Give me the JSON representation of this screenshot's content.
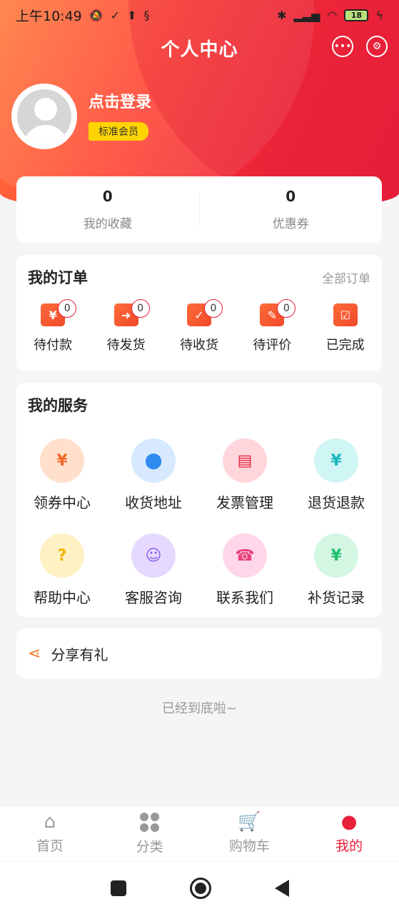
{
  "status_bar": {
    "time": "上午10:49",
    "battery": "18"
  },
  "header": {
    "title": "个人中心"
  },
  "profile": {
    "login_text": "点击登录",
    "member_level": "标准会员"
  },
  "stats": [
    {
      "value": "0",
      "label": "我的收藏"
    },
    {
      "value": "0",
      "label": "优惠券"
    }
  ],
  "orders": {
    "title": "我的订单",
    "all_link": "全部订单",
    "items": [
      {
        "label": "待付款",
        "count": "0",
        "icon": "payment-icon"
      },
      {
        "label": "待发货",
        "count": "0",
        "icon": "shipping-truck-icon"
      },
      {
        "label": "待收货",
        "count": "0",
        "icon": "receive-box-icon"
      },
      {
        "label": "待评价",
        "count": "0",
        "icon": "review-pen-icon"
      },
      {
        "label": "已完成",
        "icon": "completed-check-icon"
      }
    ]
  },
  "services": {
    "title": "我的服务",
    "items": [
      {
        "label": "领券中心",
        "icon": "coupon-icon",
        "bg": "#ffe0cc",
        "fg": "#f26a2a"
      },
      {
        "label": "收货地址",
        "icon": "location-pin-icon",
        "bg": "#d6e9ff",
        "fg": "#2f8bef"
      },
      {
        "label": "发票管理",
        "icon": "invoice-icon",
        "bg": "#ffd6dc",
        "fg": "#e8203a"
      },
      {
        "label": "退货退款",
        "icon": "refund-icon",
        "bg": "#cff5f4",
        "fg": "#1bb8c2"
      },
      {
        "label": "帮助中心",
        "icon": "help-question-icon",
        "bg": "#fff1c4",
        "fg": "#f5b400"
      },
      {
        "label": "客服咨询",
        "icon": "headset-icon",
        "bg": "#e6d9ff",
        "fg": "#8a5cf0"
      },
      {
        "label": "联系我们",
        "icon": "phone-chat-icon",
        "bg": "#ffd6ea",
        "fg": "#e8407a"
      },
      {
        "label": "补货记录",
        "icon": "restock-ticket-icon",
        "bg": "#d4f7e3",
        "fg": "#1fbf6a"
      }
    ]
  },
  "share": {
    "label": "分享有礼"
  },
  "footer_note": "已经到底啦~",
  "tabs": [
    {
      "label": "首页",
      "icon": "home-icon"
    },
    {
      "label": "分类",
      "icon": "category-grid-icon"
    },
    {
      "label": "购物车",
      "icon": "cart-icon"
    },
    {
      "label": "我的",
      "icon": "user-icon",
      "active": true
    }
  ],
  "colors": {
    "accent": "#e8203a",
    "badge": "#ffd400",
    "order_icon": "#f04a2a"
  }
}
